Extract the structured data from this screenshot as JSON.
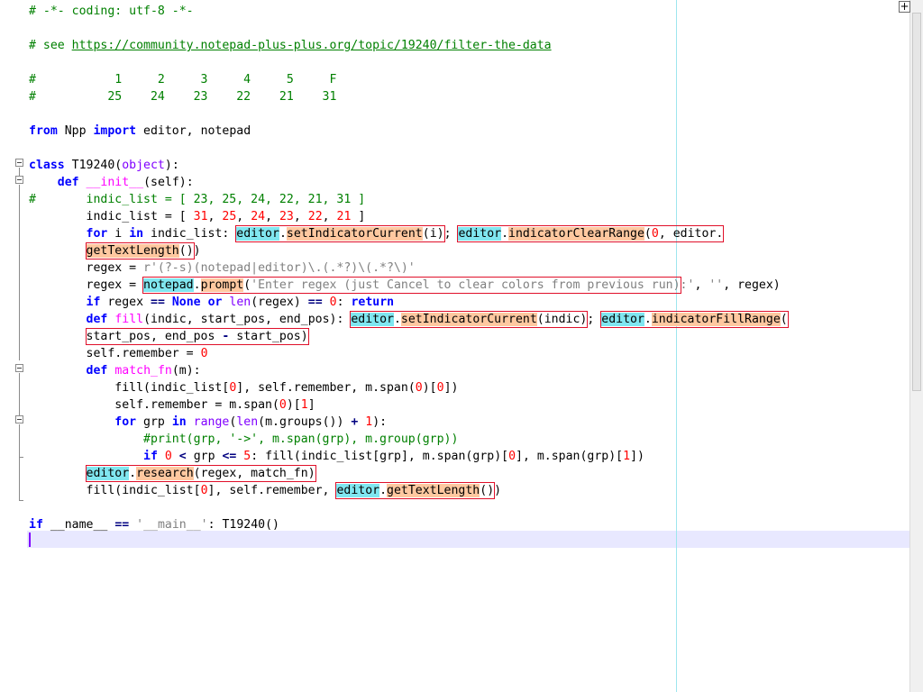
{
  "lines": [
    "# -*- coding: utf-8 -*-",
    "",
    "# see https://community.notepad-plus-plus.org/topic/19240/filter-the-data",
    "",
    "#           1     2     3     4     5     F",
    "#          25    24    23    22    21    31",
    "",
    "from Npp import editor, notepad",
    "",
    "class T19240(object):",
    "    def __init__(self):",
    "#       indic_list = [ 23, 25, 24, 22, 21, 31 ]",
    "        indic_list = [ 31, 25, 24, 23, 22, 21 ]",
    "        for i in indic_list: editor.setIndicatorCurrent(i); editor.indicatorClearRange(0, editor.",
    "        getTextLength())",
    "        regex = r'(?-s)(notepad|editor)\\.(.*?)\\(.*?\\)'",
    "        regex = notepad.prompt('Enter regex (just Cancel to clear colors from previous run):', '', regex)",
    "        if regex == None or len(regex) == 0: return",
    "        def fill(indic, start_pos, end_pos): editor.setIndicatorCurrent(indic); editor.indicatorFillRange(",
    "        start_pos, end_pos - start_pos)",
    "        self.remember = 0",
    "        def match_fn(m):",
    "            fill(indic_list[0], self.remember, m.span(0)[0])",
    "            self.remember = m.span(0)[1]",
    "            for grp in range(len(m.groups()) + 1):",
    "                #print(grp, '->', m.span(grp), m.group(grp))",
    "                if 0 < grp <= 5: fill(indic_list[grp], m.span(grp)[0], m.span(grp)[1])",
    "        editor.research(regex, match_fn)",
    "        fill(indic_list[0], self.remember, editor.getTextLength())",
    "",
    "if __name__ == '__main__': T19240()",
    ""
  ],
  "url_text": "https://community.notepad-plus-plus.org/topic/19240/filter-the-data",
  "toolbar_plus": "+",
  "colors": {
    "comment": "#008000",
    "keyword": "#0000ff",
    "builtin": "#8000ff",
    "number": "#ff0000",
    "string": "#808080",
    "current_line": "#e8e8ff",
    "indicator_cyan": "#80e6f0",
    "indicator_orange": "#ffc8a0",
    "indicator_box": "#e0102a"
  }
}
